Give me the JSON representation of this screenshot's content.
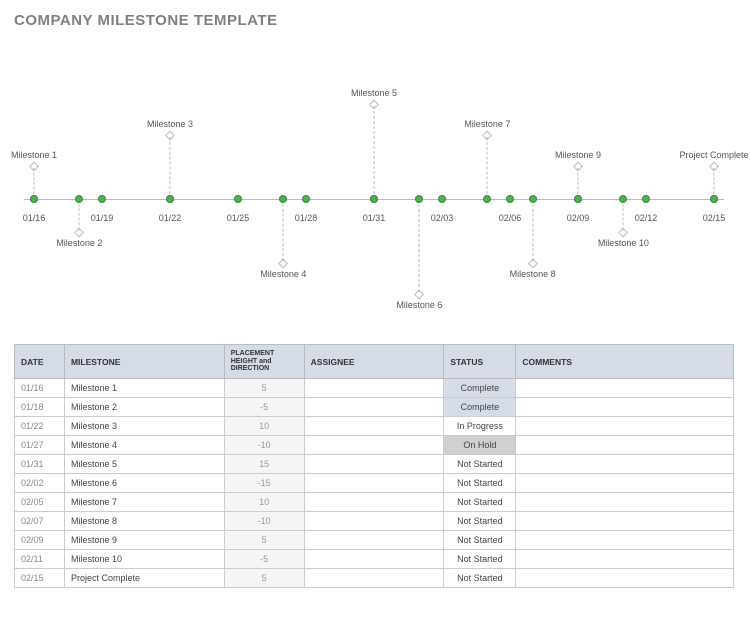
{
  "title": "COMPANY MILESTONE TEMPLATE",
  "chart_data": {
    "type": "scatter",
    "title": "",
    "xlabel": "",
    "ylabel": "",
    "x_ticks": [
      "01/16",
      "01/19",
      "01/22",
      "01/25",
      "01/28",
      "01/31",
      "02/03",
      "02/06",
      "02/09",
      "02/12",
      "02/15"
    ],
    "series": [
      {
        "name": "Milestone 1",
        "x": "01/16",
        "y": 5
      },
      {
        "name": "Milestone 2",
        "x": "01/18",
        "y": -5
      },
      {
        "name": "Milestone 3",
        "x": "01/22",
        "y": 10
      },
      {
        "name": "Milestone 4",
        "x": "01/27",
        "y": -10
      },
      {
        "name": "Milestone 5",
        "x": "01/31",
        "y": 15
      },
      {
        "name": "Milestone 6",
        "x": "02/02",
        "y": -15
      },
      {
        "name": "Milestone 7",
        "x": "02/05",
        "y": 10
      },
      {
        "name": "Milestone 8",
        "x": "02/07",
        "y": -10
      },
      {
        "name": "Milestone 9",
        "x": "02/09",
        "y": 5
      },
      {
        "name": "Milestone 10",
        "x": "02/11",
        "y": -5
      },
      {
        "name": "Project Complete",
        "x": "02/15",
        "y": 5
      }
    ],
    "ylim": [
      -15,
      15
    ]
  },
  "table": {
    "headers": {
      "date": "DATE",
      "milestone": "MILESTONE",
      "placement": "PLACEMENT HEIGHT and DIRECTION",
      "assignee": "ASSIGNEE",
      "status": "STATUS",
      "comments": "COMMENTS"
    },
    "rows": [
      {
        "date": "01/16",
        "milestone": "Milestone 1",
        "placement": "5",
        "assignee": "",
        "status": "Complete",
        "status_class": "s-complete",
        "comments": ""
      },
      {
        "date": "01/18",
        "milestone": "Milestone 2",
        "placement": "-5",
        "assignee": "",
        "status": "Complete",
        "status_class": "s-complete",
        "comments": ""
      },
      {
        "date": "01/22",
        "milestone": "Milestone 3",
        "placement": "10",
        "assignee": "",
        "status": "In Progress",
        "status_class": "s-inprogress",
        "comments": ""
      },
      {
        "date": "01/27",
        "milestone": "Milestone 4",
        "placement": "-10",
        "assignee": "",
        "status": "On Hold",
        "status_class": "s-onhold",
        "comments": ""
      },
      {
        "date": "01/31",
        "milestone": "Milestone 5",
        "placement": "15",
        "assignee": "",
        "status": "Not Started",
        "status_class": "s-notstarted",
        "comments": ""
      },
      {
        "date": "02/02",
        "milestone": "Milestone 6",
        "placement": "-15",
        "assignee": "",
        "status": "Not Started",
        "status_class": "s-notstarted",
        "comments": ""
      },
      {
        "date": "02/05",
        "milestone": "Milestone 7",
        "placement": "10",
        "assignee": "",
        "status": "Not Started",
        "status_class": "s-notstarted",
        "comments": ""
      },
      {
        "date": "02/07",
        "milestone": "Milestone 8",
        "placement": "-10",
        "assignee": "",
        "status": "Not Started",
        "status_class": "s-notstarted",
        "comments": ""
      },
      {
        "date": "02/09",
        "milestone": "Milestone 9",
        "placement": "5",
        "assignee": "",
        "status": "Not Started",
        "status_class": "s-notstarted",
        "comments": ""
      },
      {
        "date": "02/11",
        "milestone": "Milestone 10",
        "placement": "-5",
        "assignee": "",
        "status": "Not Started",
        "status_class": "s-notstarted",
        "comments": ""
      },
      {
        "date": "02/15",
        "milestone": "Project Complete",
        "placement": "5",
        "assignee": "",
        "status": "Not Started",
        "status_class": "s-notstarted",
        "comments": ""
      }
    ]
  }
}
